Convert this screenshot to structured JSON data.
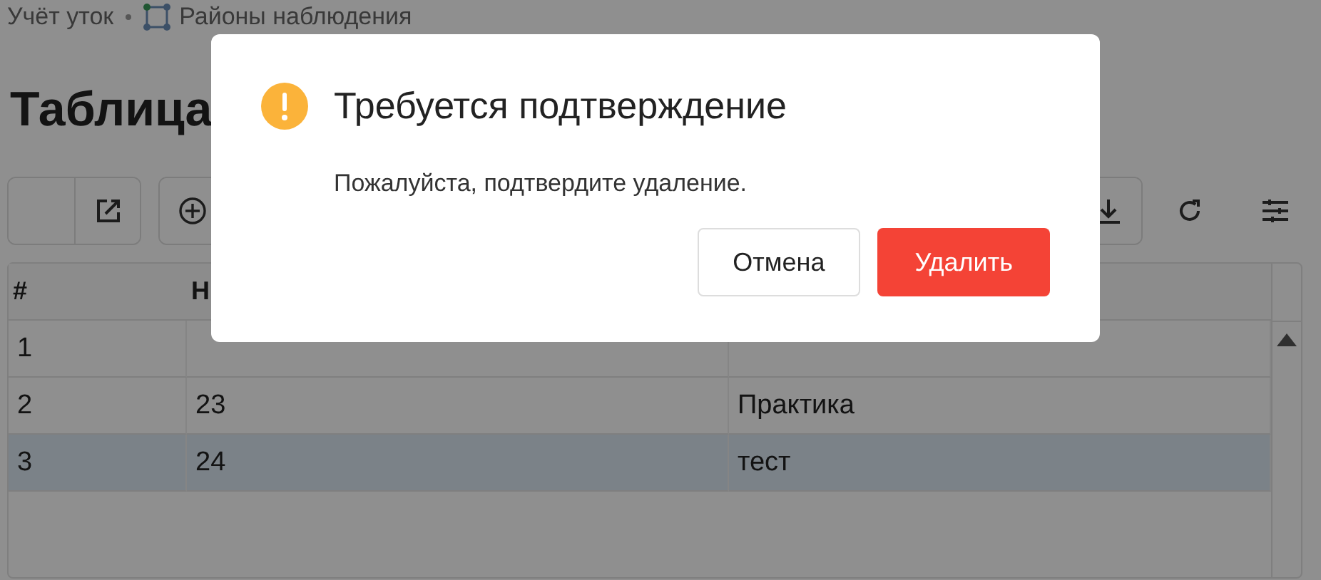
{
  "breadcrumbs": [
    {
      "label": "Учёт уток",
      "icon": false
    },
    {
      "label": "Районы наблюдения",
      "icon": true
    }
  ],
  "page_title": "Таблица",
  "table": {
    "columns": [
      "#",
      "Н"
    ],
    "rows": [
      {
        "number": "1",
        "selected": false
      },
      {
        "number": "2",
        "column_2": "23",
        "column_3": "Практика",
        "selected": false
      },
      {
        "number": "3",
        "column_2": "24",
        "column_3": "тест",
        "selected": true
      }
    ]
  },
  "dialog": {
    "title": "Требуется подтверждение",
    "message": "Пожалуйста, подтвердите удаление.",
    "buttons": [
      {
        "label": "Отмена",
        "kind": "secondary"
      },
      {
        "label": "Удалить",
        "kind": "danger"
      }
    ]
  }
}
